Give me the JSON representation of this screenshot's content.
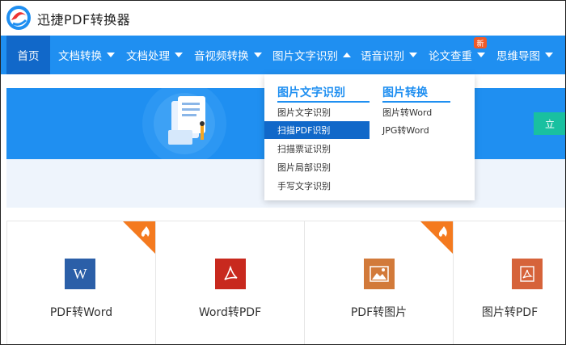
{
  "app": {
    "name": "迅捷PDF转换器"
  },
  "nav": {
    "items": [
      {
        "label": "首页",
        "active": true
      },
      {
        "label": "文档转换"
      },
      {
        "label": "文档处理"
      },
      {
        "label": "音视频转换"
      },
      {
        "label": "图片文字识别",
        "open": true
      },
      {
        "label": "语音识别"
      },
      {
        "label": "论文查重",
        "badge": "新"
      },
      {
        "label": "思维导图"
      }
    ]
  },
  "dropdown": {
    "col1": {
      "title": "图片文字识别",
      "items": [
        "图片文字识别",
        "扫描PDF识别",
        "扫描票证识别",
        "图片局部识别",
        "手写文字识别"
      ],
      "selected_index": 1
    },
    "col2": {
      "title": "图片转换",
      "items": [
        "图片转Word",
        "JPG转Word"
      ]
    }
  },
  "banner": {
    "button_label": "立"
  },
  "cards": [
    {
      "label": "PDF转Word",
      "icon": "word-doc-icon",
      "color": "#2b5fa8",
      "hot": true
    },
    {
      "label": "Word转PDF",
      "icon": "pdf-doc-icon",
      "color": "#c8291e",
      "hot": false
    },
    {
      "label": "PDF转图片",
      "icon": "image-doc-icon",
      "color": "#d27a3a",
      "hot": true
    },
    {
      "label": "图片转PDF",
      "icon": "pdf-doc-icon",
      "color": "#d6633a",
      "hot": false
    }
  ],
  "colors": {
    "nav": "#1f8ff1",
    "nav_active": "#1168c9",
    "accent_green": "#19c0a0",
    "hot": "#f47a1f"
  }
}
